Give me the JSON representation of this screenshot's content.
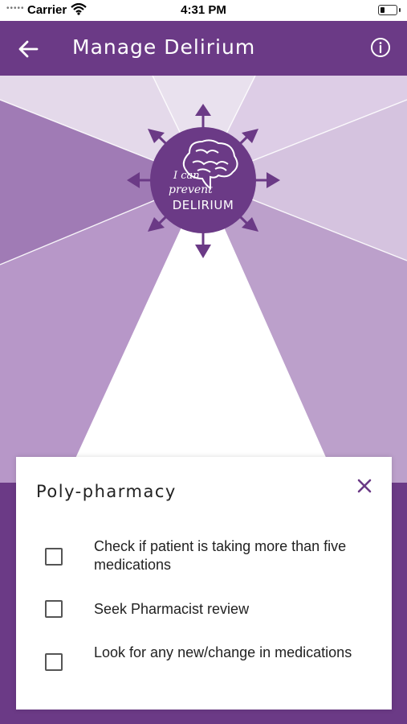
{
  "status_bar": {
    "carrier": "Carrier",
    "time": "4:31 PM",
    "icons": [
      "signal-dots-icon",
      "wifi-icon",
      "battery-icon"
    ]
  },
  "app_bar": {
    "title": "Manage Delirium",
    "back_icon": "arrow-left-icon",
    "info_icon": "info-circle-icon",
    "background": "#6b3a86"
  },
  "logo": {
    "line1": "I can",
    "line2": "prevent",
    "line3": "DELIRIUM",
    "icon": "brain-icon"
  },
  "card": {
    "title": "Poly-pharmacy",
    "close_icon": "close-icon",
    "items": [
      {
        "label": "Check if patient is taking more than five medications",
        "checked": false
      },
      {
        "label": "Seek Pharmacist review",
        "checked": false
      },
      {
        "label": "Look for any new/change in medications",
        "checked": false
      }
    ]
  },
  "colors": {
    "primary": "#6b3a86",
    "accent": "#6b3a86",
    "text": "#222222"
  }
}
